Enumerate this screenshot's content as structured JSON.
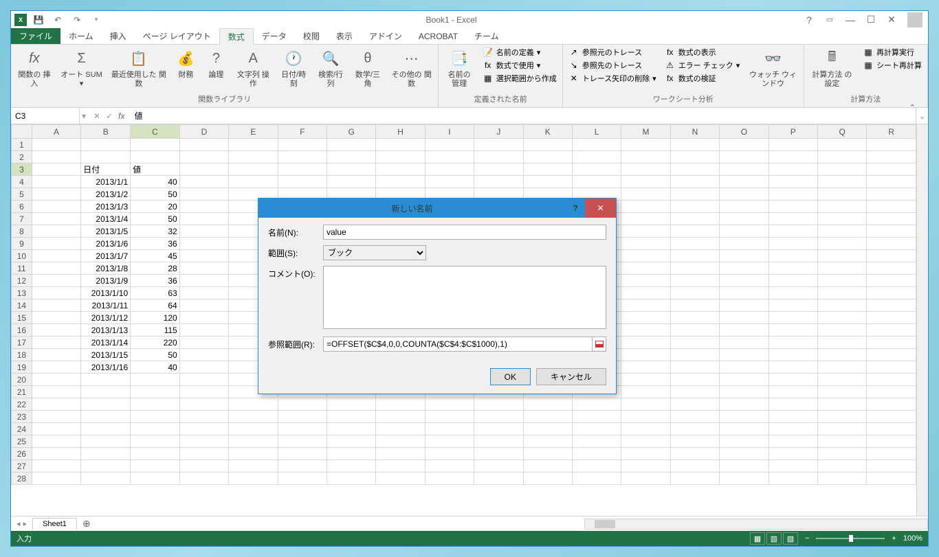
{
  "titlebar": {
    "title": "Book1 - Excel"
  },
  "tabs": {
    "file": "ファイル",
    "home": "ホーム",
    "insert": "挿入",
    "pageLayout": "ページ レイアウト",
    "formulas": "数式",
    "data": "データ",
    "review": "校閲",
    "view": "表示",
    "addin": "アドイン",
    "acrobat": "ACROBAT",
    "team": "チーム"
  },
  "ribbon": {
    "group1_label": "関数ライブラリ",
    "insertFn": "関数の\n挿入",
    "autoSum": "オート\nSUM",
    "recent": "最近使用した\n関数",
    "financial": "財務",
    "logical": "論理",
    "text": "文字列\n操作",
    "datetime": "日付/時刻",
    "lookup": "検索/行列",
    "math": "数学/三角",
    "other": "その他の\n関数",
    "group2_label": "定義された名前",
    "nameManager": "名前の\n管理",
    "defineName": "名前の定義",
    "useInFormula": "数式で使用",
    "createFromSel": "選択範囲から作成",
    "group3_label": "ワークシート分析",
    "tracePrec": "参照元のトレース",
    "traceDep": "参照先のトレース",
    "removeArrows": "トレース矢印の削除",
    "showFormulas": "数式の表示",
    "errorCheck": "エラー チェック",
    "evalFormula": "数式の検証",
    "watchWindow": "ウォッチ\nウィンドウ",
    "group4_label": "計算方法",
    "calcOptions": "計算方法\nの設定",
    "calcNow": "再計算実行",
    "calcSheet": "シート再計算"
  },
  "formulaBar": {
    "nameBox": "C3",
    "formula": "値"
  },
  "columns": [
    "A",
    "B",
    "C",
    "D",
    "E",
    "F",
    "G",
    "H",
    "I",
    "J",
    "K",
    "L",
    "M",
    "N",
    "O",
    "P",
    "Q",
    "R"
  ],
  "headers": {
    "date": "日付",
    "value": "値"
  },
  "rows": [
    {
      "r": 1
    },
    {
      "r": 2
    },
    {
      "r": 3,
      "b": "日付",
      "c": "値",
      "textLeft": true,
      "selected": true
    },
    {
      "r": 4,
      "b": "2013/1/1",
      "c": "40"
    },
    {
      "r": 5,
      "b": "2013/1/2",
      "c": "50"
    },
    {
      "r": 6,
      "b": "2013/1/3",
      "c": "20"
    },
    {
      "r": 7,
      "b": "2013/1/4",
      "c": "50"
    },
    {
      "r": 8,
      "b": "2013/1/5",
      "c": "32"
    },
    {
      "r": 9,
      "b": "2013/1/6",
      "c": "36"
    },
    {
      "r": 10,
      "b": "2013/1/7",
      "c": "45"
    },
    {
      "r": 11,
      "b": "2013/1/8",
      "c": "28"
    },
    {
      "r": 12,
      "b": "2013/1/9",
      "c": "36"
    },
    {
      "r": 13,
      "b": "2013/1/10",
      "c": "63"
    },
    {
      "r": 14,
      "b": "2013/1/11",
      "c": "64"
    },
    {
      "r": 15,
      "b": "2013/1/12",
      "c": "120"
    },
    {
      "r": 16,
      "b": "2013/1/13",
      "c": "115"
    },
    {
      "r": 17,
      "b": "2013/1/14",
      "c": "220"
    },
    {
      "r": 18,
      "b": "2013/1/15",
      "c": "50"
    },
    {
      "r": 19,
      "b": "2013/1/16",
      "c": "40"
    },
    {
      "r": 20
    },
    {
      "r": 21
    },
    {
      "r": 22
    },
    {
      "r": 23
    },
    {
      "r": 24
    },
    {
      "r": 25
    },
    {
      "r": 26
    },
    {
      "r": 27
    },
    {
      "r": 28
    }
  ],
  "sheetTabs": {
    "sheet1": "Sheet1"
  },
  "statusBar": {
    "mode": "入力",
    "zoom": "100%"
  },
  "dialog": {
    "title": "新しい名前",
    "nameLabel": "名前(N):",
    "nameValue": "value",
    "scopeLabel": "範囲(S):",
    "scopeValue": "ブック",
    "commentLabel": "コメント(O):",
    "refLabel": "参照範囲(R):",
    "refValue": "=OFFSET($C$4,0,0,COUNTA($C$4:$C$1000),1)",
    "ok": "OK",
    "cancel": "キャンセル"
  }
}
